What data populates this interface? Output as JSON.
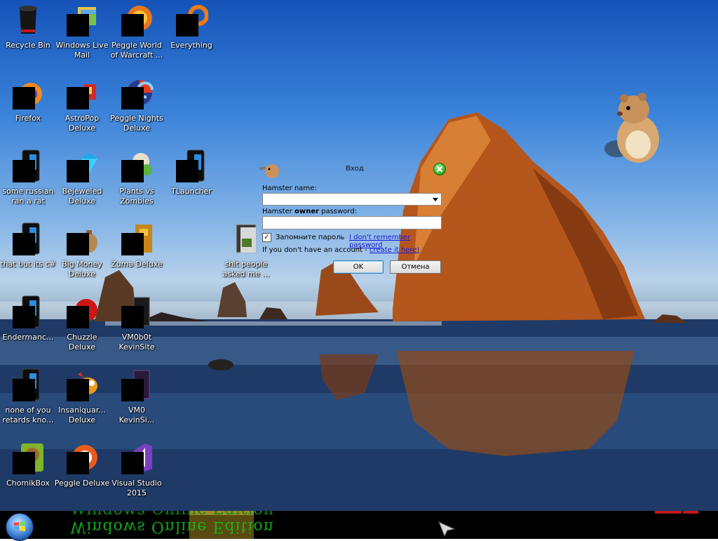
{
  "desktop": {
    "icons": [
      {
        "label": "Recycle Bin",
        "icon": "recycle-bin-icon"
      },
      {
        "label": "Windows Live\nMail",
        "icon": "windows-live-mail-icon"
      },
      {
        "label": "Peggle World\nof Warcraft ...",
        "icon": "peggle-wow-icon"
      },
      {
        "label": "Everything",
        "icon": "everything-search-icon"
      },
      {
        "label": "Firefox",
        "icon": "firefox-icon"
      },
      {
        "label": "AstroPop\nDeluxe",
        "icon": "astropop-icon"
      },
      {
        "label": "Peggle Nights\nDeluxe",
        "icon": "peggle-nights-icon"
      },
      {
        "label": "some russian\nran a rat",
        "icon": "app-file-icon"
      },
      {
        "label": "Bejeweled\nDeluxe",
        "icon": "bejeweled-icon"
      },
      {
        "label": "Plants vs\nZombies",
        "icon": "plants-vs-zombies-icon"
      },
      {
        "label": "TLauncher",
        "icon": "tlauncher-icon"
      },
      {
        "label": "that but its c#",
        "icon": "app-file-icon"
      },
      {
        "label": "Big Money\nDeluxe",
        "icon": "big-money-icon"
      },
      {
        "label": "Zuma Deluxe",
        "icon": "zuma-icon"
      },
      {
        "label": "shit people\nasked me ...",
        "icon": "folder-icon"
      },
      {
        "label": "Endermanc...",
        "icon": "app-file-icon"
      },
      {
        "label": "Chuzzle\nDeluxe",
        "icon": "chuzzle-icon"
      },
      {
        "label": "VM0b0t\nKevinSite",
        "icon": "vm-file-icon"
      },
      {
        "label": "none of you\nretards kno...",
        "icon": "app-file-icon"
      },
      {
        "label": "Insaniquar...\nDeluxe",
        "icon": "insaniquarium-icon"
      },
      {
        "label": "VM0\nKevinSi...",
        "icon": "vm-file-icon"
      },
      {
        "label": "ChomikBox",
        "icon": "chomikbox-icon"
      },
      {
        "label": "Peggle Deluxe",
        "icon": "peggle-deluxe-icon"
      },
      {
        "label": "Visual Studio\n2015",
        "icon": "visual-studio-icon"
      }
    ]
  },
  "login_dialog": {
    "title": "Вход",
    "name_label": "Hamster name:",
    "password_label_pre": "Hamster ",
    "password_label_bold": "owner",
    "password_label_post": " password:",
    "name_value": "",
    "password_value": "",
    "remember_label": "Запомните пароль",
    "remember_checked": true,
    "forgot_link": "I don't remember password",
    "no_account_text": "If you don't have an account - ",
    "create_link": "create it here!",
    "ok_label": "OK",
    "cancel_label": "Отмена"
  },
  "taskbar": {
    "banner_text": "Windows Online Edition"
  }
}
